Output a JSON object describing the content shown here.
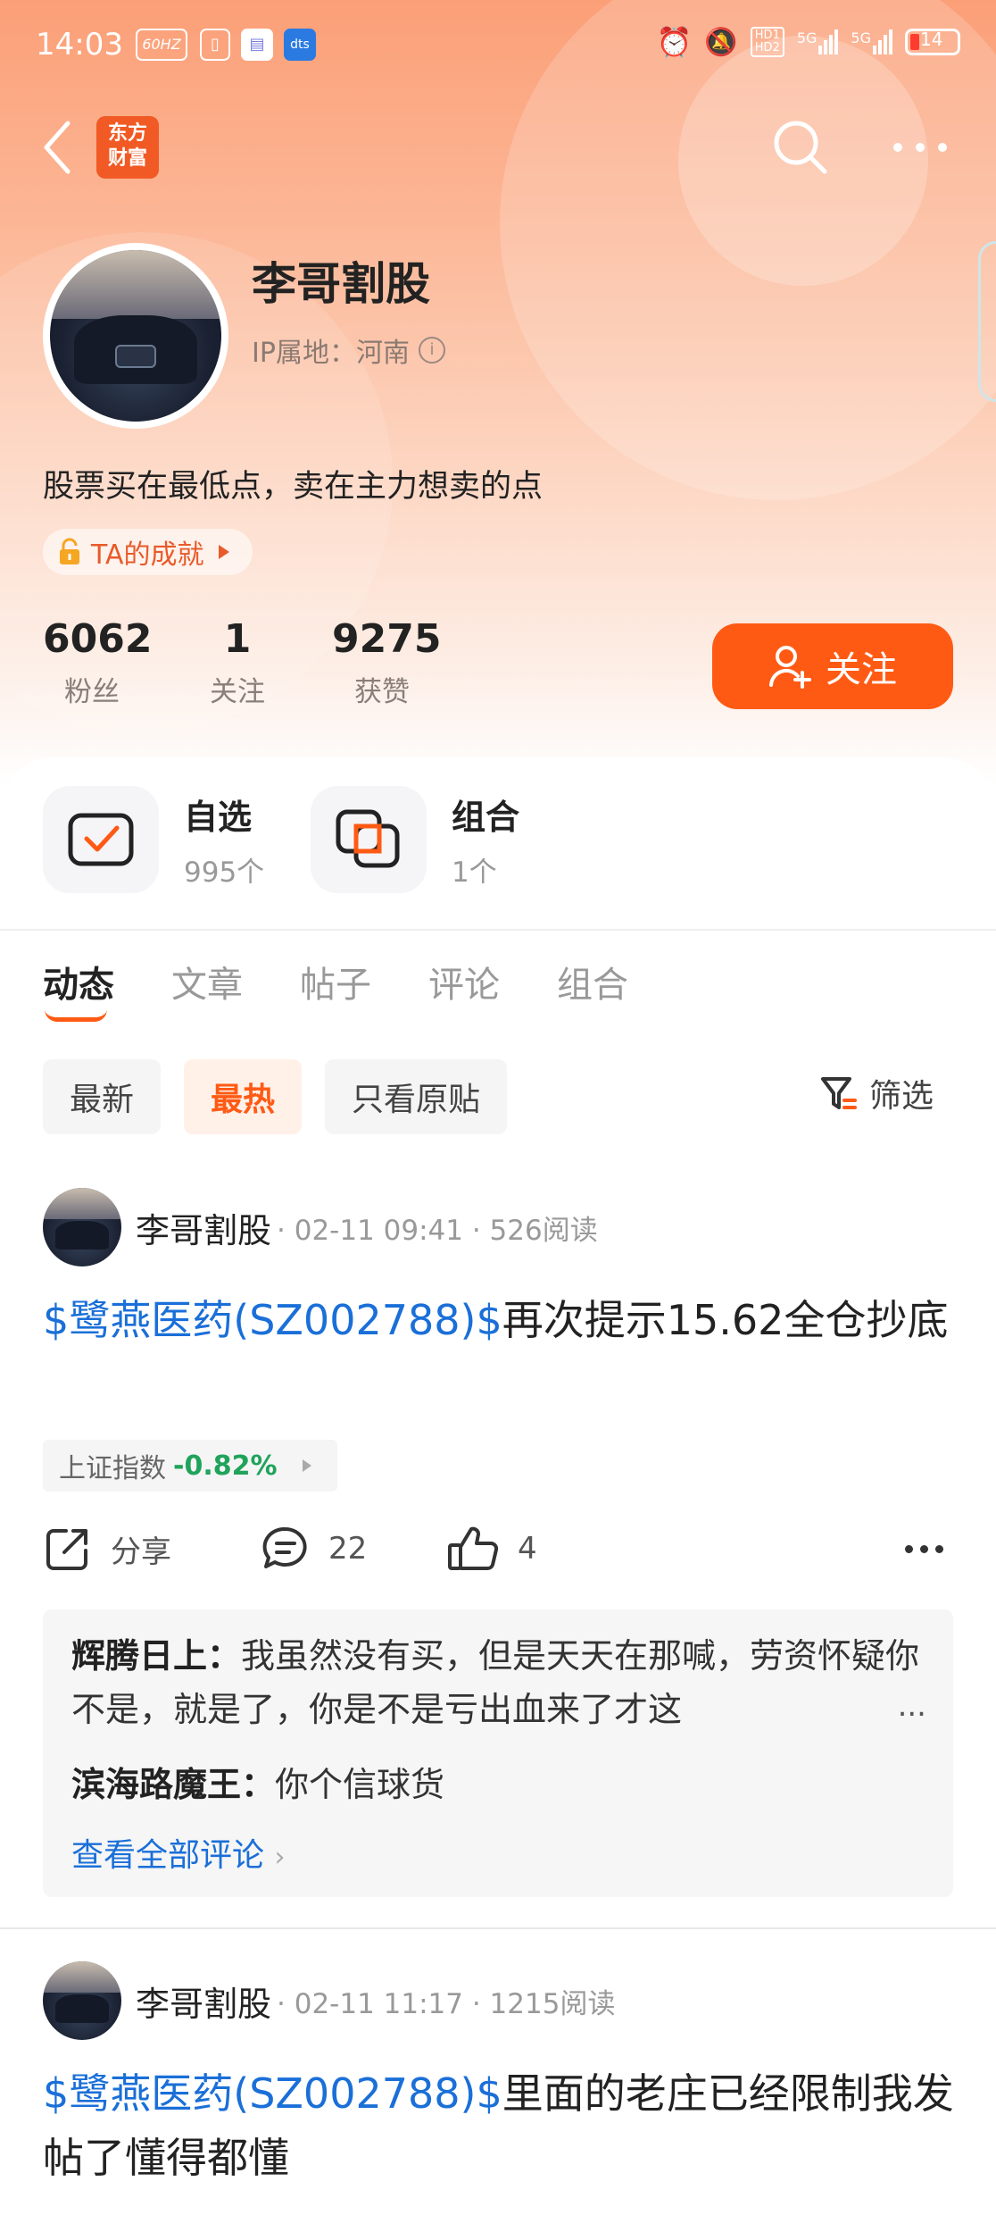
{
  "status_bar": {
    "time": "14:03",
    "refresh_rate": "60HZ",
    "net1": "HD1",
    "net2": "HD2",
    "sig1": "5G",
    "sig2": "5G",
    "battery": "14"
  },
  "nav": {
    "logo_line1": "东方",
    "logo_line2": "财富"
  },
  "profile": {
    "name": "李哥割股",
    "ip_location": "IP属地：河南",
    "bio": "股票买在最低点，卖在主力想卖的点",
    "achievement": "TA的成就",
    "stats": [
      {
        "value": "6062",
        "label": "粉丝"
      },
      {
        "value": "1",
        "label": "关注"
      },
      {
        "value": "9275",
        "label": "获赞"
      }
    ],
    "follow_label": "关注"
  },
  "quick": {
    "watchlist_title": "自选",
    "watchlist_count": "995个",
    "portfolio_title": "组合",
    "portfolio_count": "1个"
  },
  "tabs": [
    "动态",
    "文章",
    "帖子",
    "评论",
    "组合"
  ],
  "chips": [
    "最新",
    "最热",
    "只看原贴"
  ],
  "filter_label": "筛选",
  "posts": [
    {
      "author": "李哥割股",
      "meta": "· 02-11 09:41 · 526阅读",
      "stock": "$鹭燕医药(SZ002788)$",
      "text": "再次提示15.62全仓抄底",
      "index_name": "上证指数",
      "index_change": "-0.82%",
      "share_label": "分享",
      "comment_count": "22",
      "like_count": "4",
      "comments": [
        {
          "user": "辉腾日上：",
          "text": "我虽然没有买，但是天天在那喊，劳资怀疑你不是，就是了，你是不是亏出血来了才这"
        },
        {
          "user": "滨海路魔王：",
          "text": "你个信球货"
        }
      ],
      "ellipsis": "...",
      "view_all": "查看全部评论"
    },
    {
      "author": "李哥割股",
      "meta": "· 02-11 11:17 · 1215阅读",
      "stock": "$鹭燕医药(SZ002788)$",
      "text": "里面的老庄已经限制我发帖了懂得都懂"
    }
  ],
  "colors": {
    "accent": "#ff5a14",
    "link": "#1a6fd8",
    "down": "#20a35a"
  }
}
